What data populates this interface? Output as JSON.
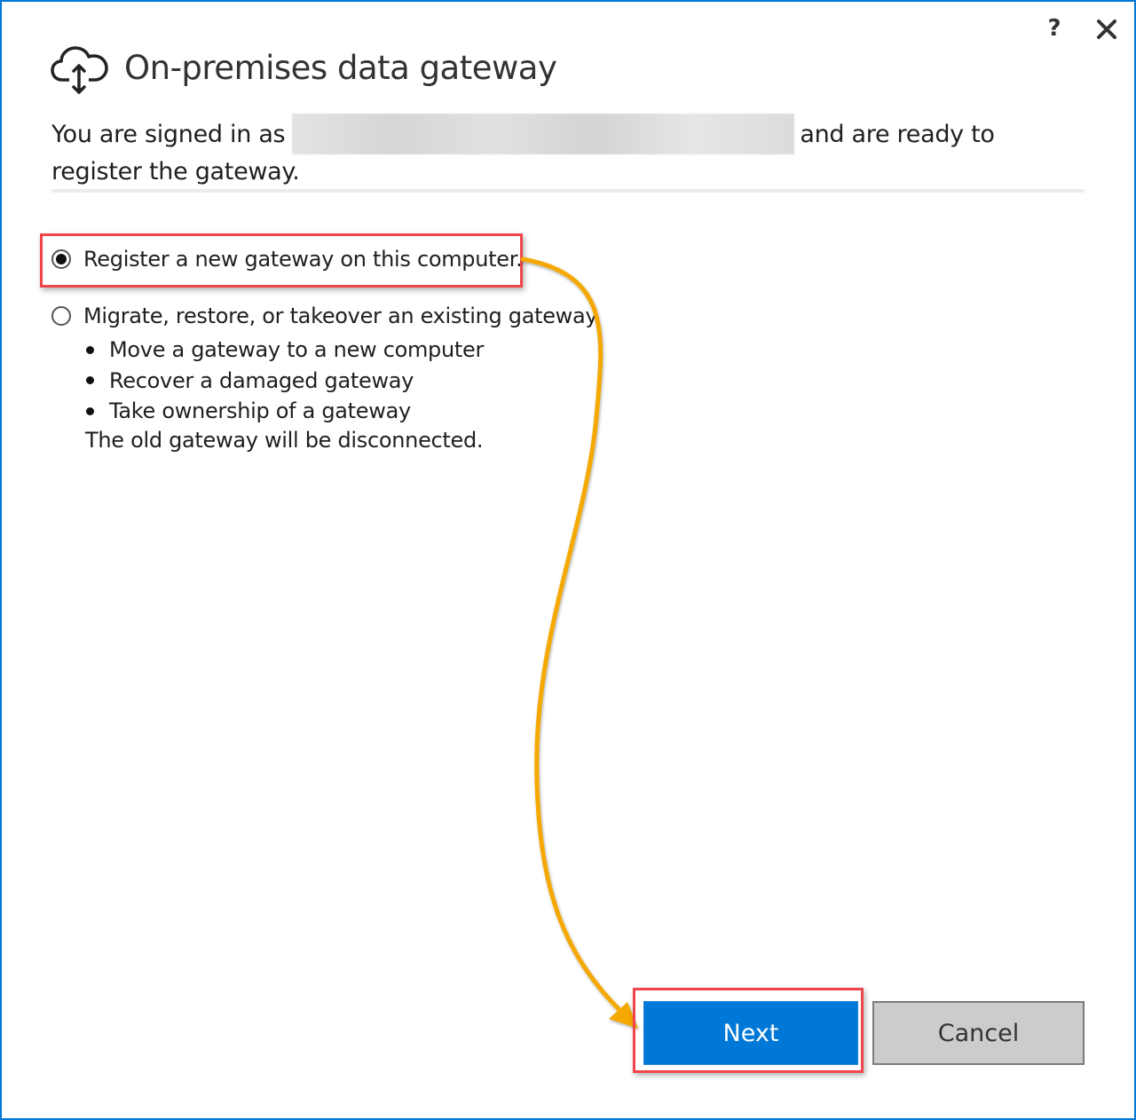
{
  "window": {
    "title": "On-premises data gateway",
    "help_label": "?",
    "close_label": "close",
    "accent_color": "#0078d7"
  },
  "intro": {
    "prefix": "You are signed in as",
    "account": "",
    "suffix": "and are ready to register the gateway."
  },
  "options": [
    {
      "label": "Register a new gateway on this computer.",
      "selected": true
    },
    {
      "label": "Migrate, restore, or takeover an existing gateway.",
      "selected": false
    }
  ],
  "migrate_details": {
    "bullets": [
      "Move a gateway to a new computer",
      "Recover a damaged gateway",
      "Take ownership of a gateway"
    ],
    "note": "The old gateway will be disconnected."
  },
  "buttons": {
    "next_label": "Next",
    "cancel_label": "Cancel"
  },
  "annotations": {
    "highlight_color": "#f0464b",
    "arrow_color": "#f5a800"
  }
}
